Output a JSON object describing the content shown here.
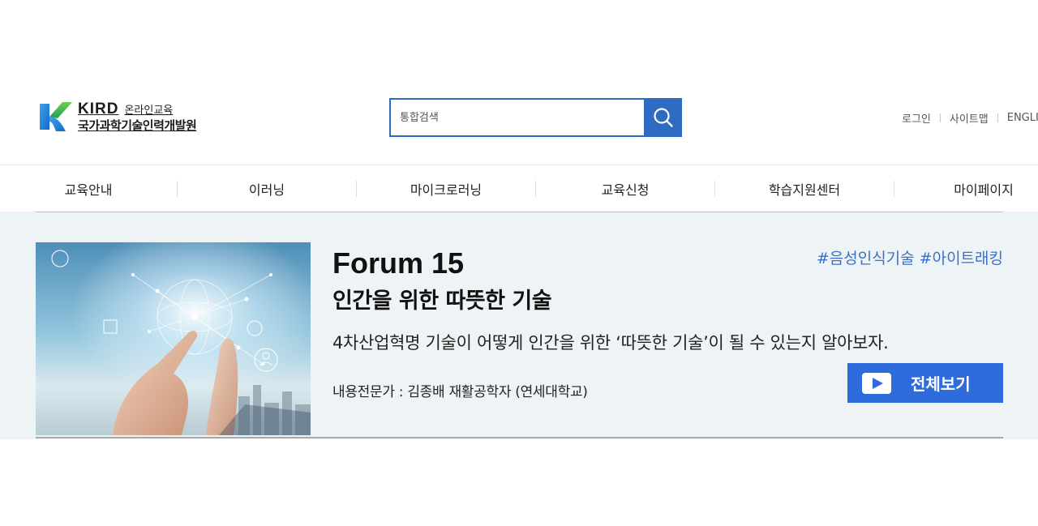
{
  "header": {
    "brand": "KIRD",
    "brand_sub": "온라인교육",
    "org_name": "국가과학기술인력개발원",
    "search": {
      "placeholder": "통합검색"
    },
    "util_links": [
      "로그인",
      "사이트맵",
      "ENGLISH"
    ]
  },
  "nav": {
    "items": [
      "교육안내",
      "이러닝",
      "마이크로러닝",
      "교육신청",
      "학습지원센터",
      "마이페이지"
    ]
  },
  "banner": {
    "title": "Forum 15",
    "subtitle": "인간을 위한 따뜻한 기술",
    "tags": "#음성인식기술 #아이트래킹",
    "description": "4차산업혁명 기술이 어떻게 인간을 위한 ‘따뜻한 기술’이 될 수 있는지 알아보자.",
    "expert": "내용전문가 : 김종배 재활공학자 (연세대학교)",
    "view_all_label": "전체보기"
  },
  "colors": {
    "accent": "#2e6cc4",
    "button": "#2e6cdc",
    "tag": "#3d6fc7",
    "banner_bg": "#eef4f6"
  },
  "icons": {
    "logo": "kird-k-logo",
    "search": "search-icon",
    "play": "play-icon"
  }
}
